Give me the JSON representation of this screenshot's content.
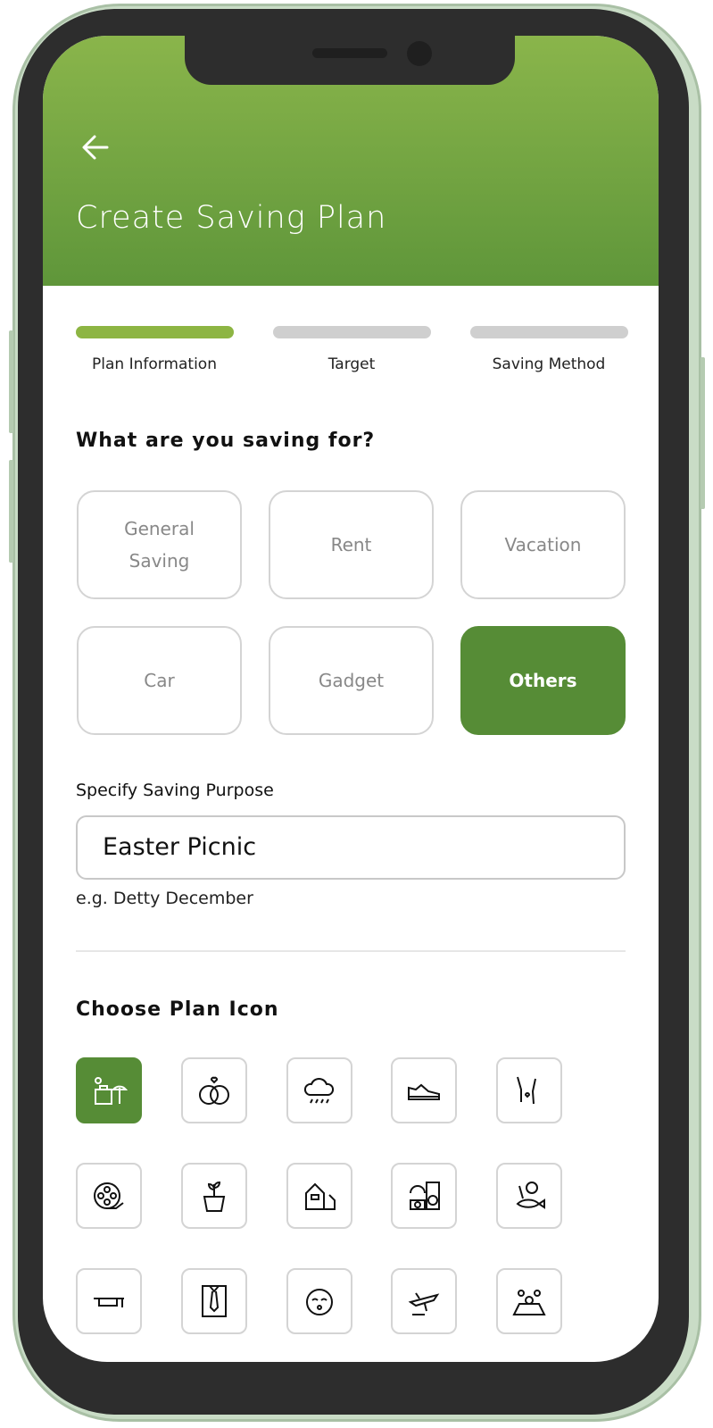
{
  "header": {
    "title": "Create Saving Plan",
    "back_icon": "arrow-left-icon"
  },
  "steps": [
    {
      "label": "Plan Information",
      "active": true
    },
    {
      "label": "Target",
      "active": false
    },
    {
      "label": "Saving Method",
      "active": false
    }
  ],
  "purpose": {
    "heading": "What are you saving for?",
    "options": [
      {
        "label": "General Saving"
      },
      {
        "label": "Rent"
      },
      {
        "label": "Vacation"
      },
      {
        "label": "Car"
      },
      {
        "label": "Gadget"
      },
      {
        "label": "Others",
        "selected": true
      }
    ]
  },
  "specify": {
    "label": "Specify Saving Purpose",
    "value": "Easter Picnic",
    "hint": "e.g. Detty December"
  },
  "icons": {
    "heading": "Choose Plan Icon",
    "items": [
      "vacation-icon",
      "wedding-rings-icon",
      "rain-cloud-icon",
      "sneaker-icon",
      "champagne-toast-icon",
      "film-reel-icon",
      "money-plant-icon",
      "house-icon",
      "music-photo-gear-icon",
      "groceries-icon",
      "graduation-cap-icon",
      "shirt-tie-icon",
      "baby-icon",
      "airplane-icon",
      "map-pins-icon"
    ],
    "selected": 0
  },
  "colors": {
    "primary": "#568c36",
    "progress_active": "#8db543",
    "header_top": "#8ab54b",
    "header_bottom": "#5f963a"
  }
}
